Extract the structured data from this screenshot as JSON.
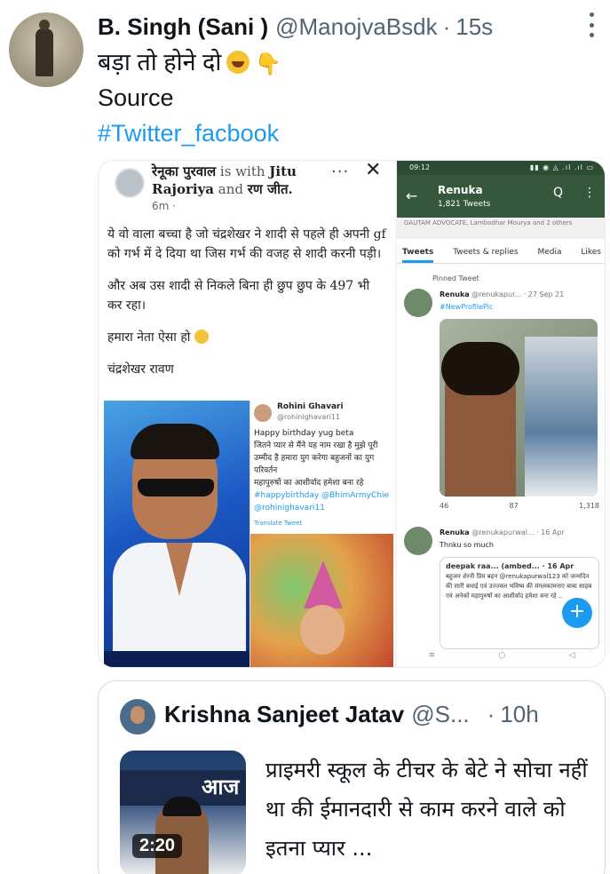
{
  "tweet": {
    "author_name": "B. Singh (Sani )",
    "handle": "@ManojvaBsdk",
    "separator": "·",
    "time": "15s",
    "text_line1": "बड़ा तो होने दो",
    "text_line2": "Source",
    "hashtag": "#Twitter_facbook",
    "emoji_icons": [
      "rolling-laughing-emoji",
      "pointing-down-emoji"
    ]
  },
  "media": {
    "facebook_post": {
      "author": "रेनूका पुरवाल",
      "with_text": "is with",
      "tagged1": "Jitu Rajoriya",
      "and_text": "and",
      "tagged2": "रण जीत.",
      "time": "6m ·",
      "more": "···",
      "close": "✕",
      "para1": "ये वो वाला बच्चा है जो चंद्रशेखर ने शादी से पहले ही अपनी gf को गर्भ में दे दिया था जिस गर्भ की वजह से शादी करनी पड़ी।",
      "para2": "और अब उस शादी से निकले बिना ही छुप छुप के 497 भी कर रहा।",
      "para3": "हमारा नेता ऐसा हो",
      "para4": "चंद्रशेखर रावण",
      "embedded_card": {
        "name": "Rohini Ghavari",
        "handle": "@rohinighavari11",
        "line1": "Happy birthday yug beta",
        "line2": "जितने प्यार से मैंने यह नाम रखा है मुझे पूरी उम्मीद है हमारा युग करेगा बहुजनों का युग परिवर्तन",
        "line3": "महापुरुषों का आशीर्वाद हमेशा बना रहे",
        "tags": "#happybirthday @BhimArmyChie @rohinighavari11",
        "translate": "Translate Tweet"
      }
    },
    "phone_screenshot": {
      "status_time": "09:12",
      "status_icons": "▮▮ ◉ ◬ .ıl .ıl ▭",
      "back": "←",
      "profile_name": "Renuka",
      "tweet_count": "1,821 Tweets",
      "search_icon": "Q",
      "kebab": "⋮",
      "subnote": "GAUTAM ADVOCATE, Lambodhar Mourya and 2 others",
      "tabs": [
        "Tweets",
        "Tweets & replies",
        "Media",
        "Likes"
      ],
      "pinned": "Pinned Tweet",
      "t1_name": "Renuka",
      "t1_handle": "@renukapur... · 27 Sep 21",
      "t1_tag": "#NewProfilePic",
      "actions": [
        "46",
        "87",
        "1,318"
      ],
      "t2_name": "Renuka",
      "t2_handle": "@renukapurwal... · 16 Apr",
      "t2_text": "Thnku so much",
      "quote_name": "deepak raa... (ambed... · 16 Apr",
      "quote_text": "बहुजन शेरनी प्रिय बहन @renukapurwal123 को जन्मदिन की सारी बधाई एवं उज्ज्वल भविष्य की मंगलकामनाए बाबा साहब एवं अनेकों महापुरुषों का आशीर्वाद हमेशा बना रहे ..",
      "fab": "+",
      "nav": [
        "≡",
        "○",
        "◁"
      ]
    }
  },
  "quoted_tweet": {
    "author_name": "Krishna Sanjeet Jatav",
    "handle": "@S...",
    "separator": "·",
    "time": "10h",
    "video_duration": "2:20",
    "thumb_banner": "आज",
    "text": "प्राइमरी स्कूल के टीचर के बेटे ने सोचा नहीं था की ईमानदारी से काम करने वाले को इतना प्यार ..."
  },
  "colors": {
    "link": "#1d9bf0",
    "muted": "#536471",
    "text": "#0f1419",
    "border": "#cfd9de"
  }
}
